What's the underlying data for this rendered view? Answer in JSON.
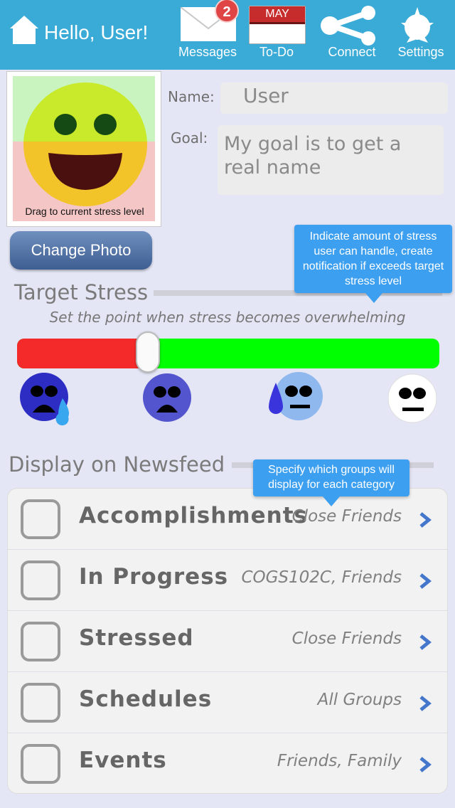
{
  "header": {
    "greeting": "Hello, User!",
    "messages_label": "Messages",
    "messages_count": "2",
    "todo_label": "To-Do",
    "todo_month": "MAY",
    "connect_label": "Connect",
    "settings_label": "Settings"
  },
  "profile": {
    "photo_caption": "Drag to current stress level",
    "name_label": "Name:",
    "name_value": "User",
    "goal_label": "Goal:",
    "goal_value": "My goal is to get a real name",
    "change_photo_label": "Change Photo"
  },
  "target_stress": {
    "title": "Target Stress",
    "subtitle": "Set the point when stress becomes overwhelming",
    "tooltip": "Indicate amount of stress user can handle, create notification if exceeds target stress level",
    "level": 0.31
  },
  "newsfeed": {
    "title": "Display on Newsfeed",
    "tooltip": "Specify which groups will display for each category",
    "rows": [
      {
        "label": "Accomplishments",
        "value": "Close Friends",
        "checked": false
      },
      {
        "label": "In Progress",
        "value": "COGS102C, Friends",
        "checked": false
      },
      {
        "label": "Stressed",
        "value": "Close Friends",
        "checked": false
      },
      {
        "label": "Schedules",
        "value": "All Groups",
        "checked": false
      },
      {
        "label": "Events",
        "value": "Friends, Family",
        "checked": false
      }
    ]
  },
  "colors": {
    "topbar": "#3aaad6",
    "slider_low": "#f42a2a",
    "slider_high": "#00ff00",
    "tooltip": "#3d9ff0"
  }
}
